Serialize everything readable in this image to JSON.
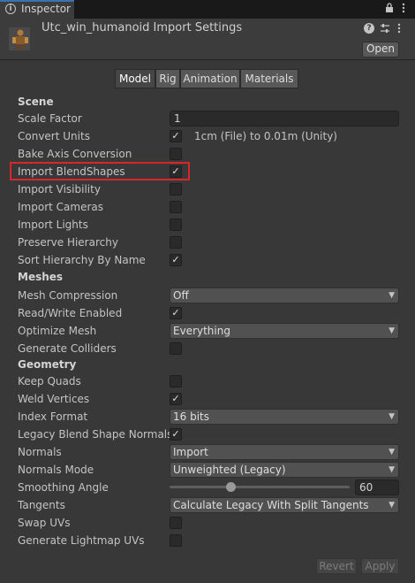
{
  "window": {
    "tab_label": "Inspector",
    "tab_icon": "info-icon",
    "controls": [
      "lock-icon",
      "kebab-menu-icon"
    ]
  },
  "header": {
    "title": "Utc_win_humanoid Import Settings",
    "asset_icon": "model-prefab-icon",
    "icons": [
      "help-icon",
      "preset-sliders-icon",
      "kebab-menu-icon"
    ],
    "open_label": "Open"
  },
  "tabs": [
    {
      "label": "Model",
      "active": true
    },
    {
      "label": "Rig",
      "active": false
    },
    {
      "label": "Animation",
      "active": false
    },
    {
      "label": "Materials",
      "active": false
    }
  ],
  "sections": {
    "scene": "Scene",
    "meshes": "Meshes",
    "geometry": "Geometry"
  },
  "scene": {
    "scale_factor": {
      "label": "Scale Factor",
      "value": "1"
    },
    "convert_units": {
      "label": "Convert Units",
      "checked": true,
      "note": "1cm (File) to 0.01m (Unity)"
    },
    "bake_axis": {
      "label": "Bake Axis Conversion",
      "checked": false
    },
    "import_blendshapes": {
      "label": "Import BlendShapes",
      "checked": true
    },
    "import_visibility": {
      "label": "Import Visibility",
      "checked": false
    },
    "import_cameras": {
      "label": "Import Cameras",
      "checked": false
    },
    "import_lights": {
      "label": "Import Lights",
      "checked": false
    },
    "preserve_hierarchy": {
      "label": "Preserve Hierarchy",
      "checked": false
    },
    "sort_hierarchy": {
      "label": "Sort Hierarchy By Name",
      "checked": true
    }
  },
  "meshes": {
    "mesh_compression": {
      "label": "Mesh Compression",
      "value": "Off"
    },
    "read_write": {
      "label": "Read/Write Enabled",
      "checked": true
    },
    "optimize_mesh": {
      "label": "Optimize Mesh",
      "value": "Everything"
    },
    "generate_colliders": {
      "label": "Generate Colliders",
      "checked": false
    }
  },
  "geometry": {
    "keep_quads": {
      "label": "Keep Quads",
      "checked": false
    },
    "weld_vertices": {
      "label": "Weld Vertices",
      "checked": true
    },
    "index_format": {
      "label": "Index Format",
      "value": "16 bits"
    },
    "legacy_blend_normals": {
      "label": "Legacy Blend Shape Normals",
      "checked": true
    },
    "normals": {
      "label": "Normals",
      "value": "Import"
    },
    "normals_mode": {
      "label": "Normals Mode",
      "value": "Unweighted (Legacy)"
    },
    "smoothing_angle": {
      "label": "Smoothing Angle",
      "value": "60"
    },
    "tangents": {
      "label": "Tangents",
      "value": "Calculate Legacy With Split Tangents"
    },
    "swap_uvs": {
      "label": "Swap UVs",
      "checked": false
    },
    "lightmap_uvs": {
      "label": "Generate Lightmap UVs",
      "checked": false
    }
  },
  "footer": {
    "revert_label": "Revert",
    "apply_label": "Apply"
  },
  "colors": {
    "highlight": "#d9262a",
    "panel": "#383838",
    "active_tab_accent": "#3a72b0"
  }
}
